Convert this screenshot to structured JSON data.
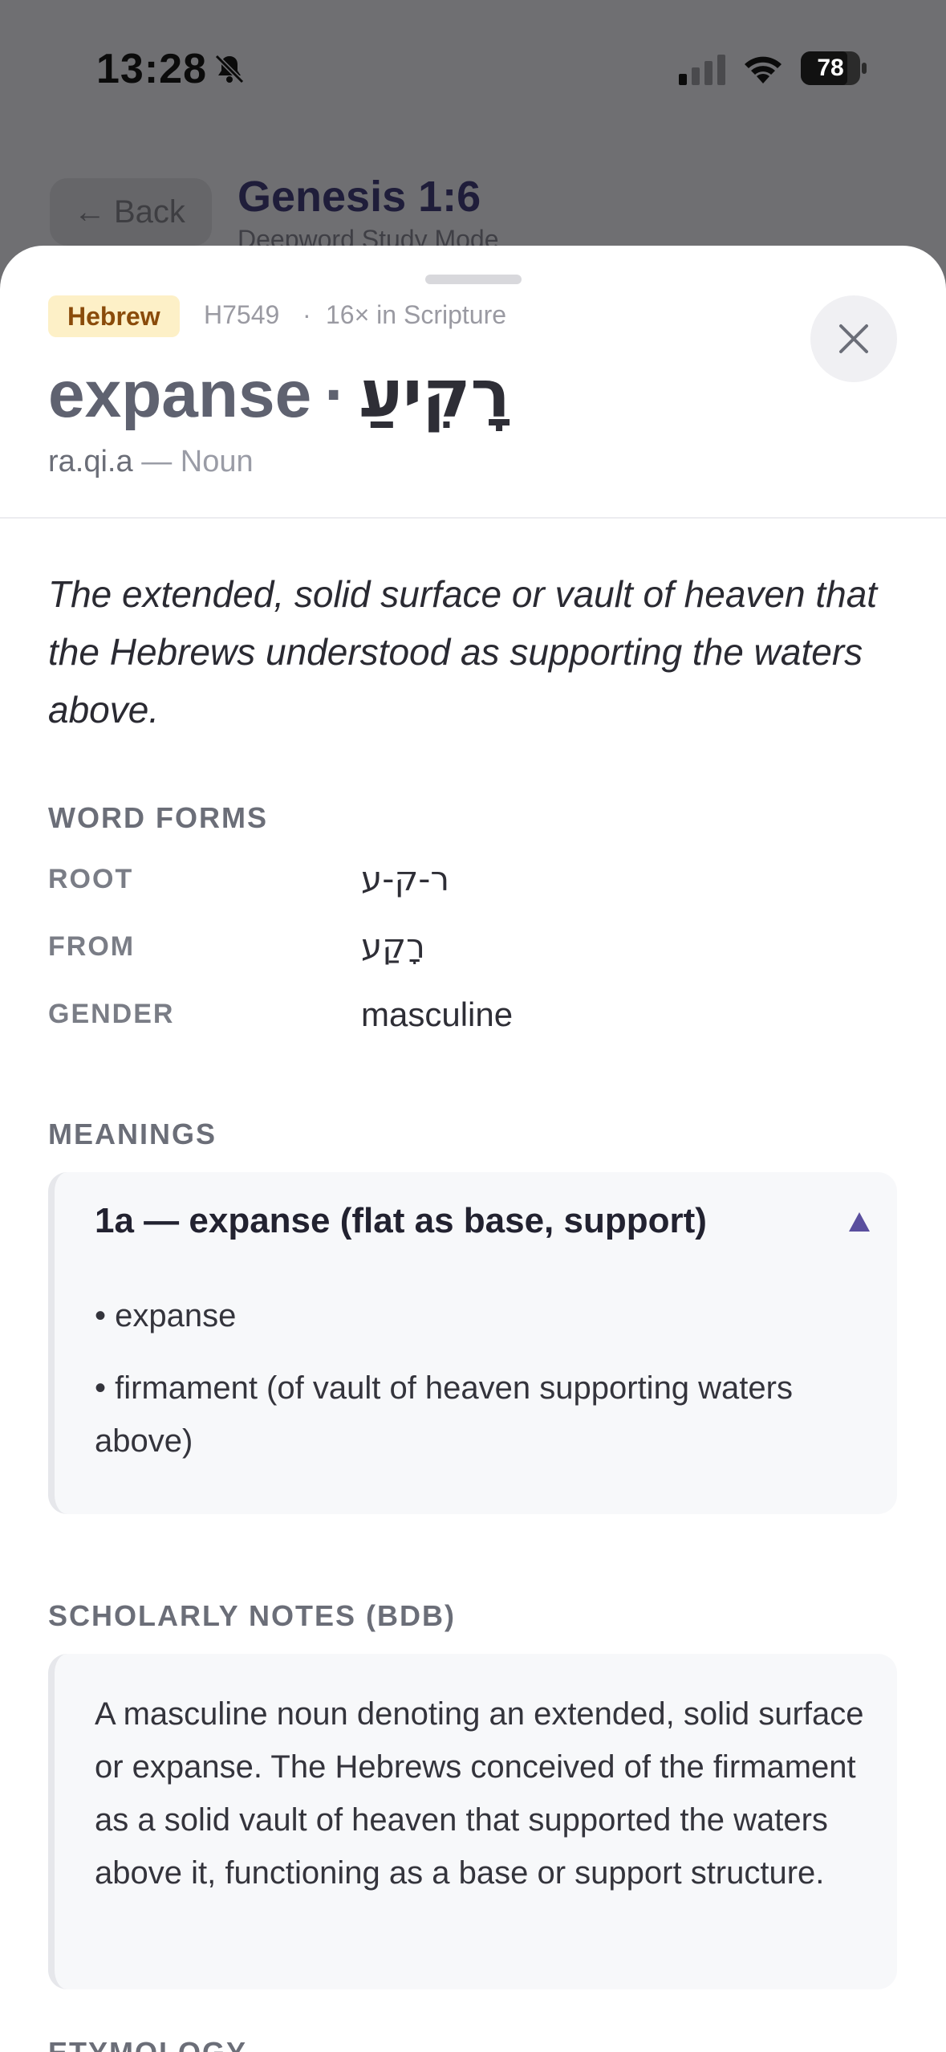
{
  "status_bar": {
    "time": "13:28",
    "battery": "78"
  },
  "background": {
    "back_label": "Back",
    "title": "Genesis 1:6",
    "subtitle": "Deepword Study Mode"
  },
  "sheet": {
    "language_tag": "Hebrew",
    "strongs": "H7549",
    "separator": "·",
    "occurrences": "16× in Scripture",
    "headword": "expanse",
    "headword_sep": "·",
    "hebrew": "רָקִיעַ",
    "transliteration": "ra.qi.a",
    "part_of_speech": "— Noun",
    "definition": "The extended, solid surface or vault of heaven that the Hebrews understood as supporting the waters above.",
    "word_forms": {
      "title": "WORD FORMS",
      "rows": [
        {
          "label": "ROOT",
          "value": "ר-ק-ע"
        },
        {
          "label": "FROM",
          "value": "רָקַע"
        },
        {
          "label": "GENDER",
          "value": "masculine"
        }
      ]
    },
    "meanings": {
      "title": "MEANINGS",
      "items": [
        {
          "heading": "1a — expanse (flat as base, support)",
          "bullets": [
            "• expanse",
            "• firmament (of vault of heaven supporting waters above)"
          ]
        }
      ]
    },
    "scholarly_notes": {
      "title": "SCHOLARLY NOTES (BDB)",
      "text": "A masculine noun denoting an extended, solid surface or expanse. The Hebrews conceived of the firmament as a solid vault of heaven that supported the waters above it, functioning as a base or support structure."
    },
    "next_section_title": "ETYMOLOGY"
  },
  "colors": {
    "tag_bg": "#fdf0c7",
    "tag_text": "#8a4b0a",
    "accent": "#5a4f9e"
  }
}
